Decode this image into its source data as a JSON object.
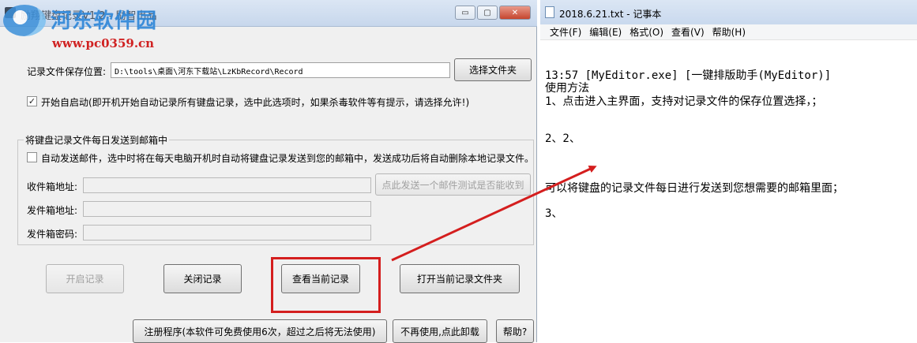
{
  "app": {
    "title": "励翔键盘记录V1.2 - 励智出品",
    "watermark": {
      "text": "河东软件园",
      "url": "www.pc0359.cn"
    },
    "window_buttons": {
      "minimize": "▭",
      "maximize": "▢",
      "close": "✕"
    },
    "save_location": {
      "label": "记录文件保存位置:",
      "value": "D:\\tools\\桌面\\河东下载站\\LzKbRecord\\Record",
      "select_button": "选择文件夹"
    },
    "autostart": {
      "checked": true,
      "mark": "✓",
      "label": "开始自启动(即开机开始自动记录所有键盘记录，选中此选项时，如果杀毒软件等有提示，请选择允许!)"
    },
    "email_group": {
      "title": "将键盘记录文件每日发送到邮箱中",
      "auto_send": {
        "checked": false,
        "label": "自动发送邮件，选中时将在每天电脑开机时自动将键盘记录发送到您的邮箱中，发送成功后将自动删除本地记录文件。"
      },
      "inbox_label": "收件箱地址:",
      "sender_label": "发件箱地址:",
      "password_label": "发件箱密码:",
      "test_button": "点此发送一个邮件测试是否能收到"
    },
    "buttons": {
      "start": "开启记录",
      "stop": "关闭记录",
      "view": "查看当前记录",
      "open_folder": "打开当前记录文件夹",
      "register": "注册程序(本软件可免费使用6次，超过之后将无法使用)",
      "uninstall": "不再使用,点此卸载",
      "help": "帮助?"
    }
  },
  "notepad": {
    "title": "2018.6.21.txt - 记事本",
    "menu": [
      "文件(F)",
      "编辑(E)",
      "格式(O)",
      "查看(V)",
      "帮助(H)"
    ],
    "lines": [
      "13:57 [MyEditor.exe] [一键排版助手(MyEditor)]",
      "使用方法",
      "1、点击进入主界面，支持对记录文件的保存位置选择，；",
      "2、2、",
      "可以将键盘的记录文件每日进行发送到您想需要的邮箱里面；",
      "3、"
    ]
  },
  "colors": {
    "highlight": "#d41e1e",
    "arrow": "#d41e1e",
    "watermark_blue": "#2d86d8"
  }
}
